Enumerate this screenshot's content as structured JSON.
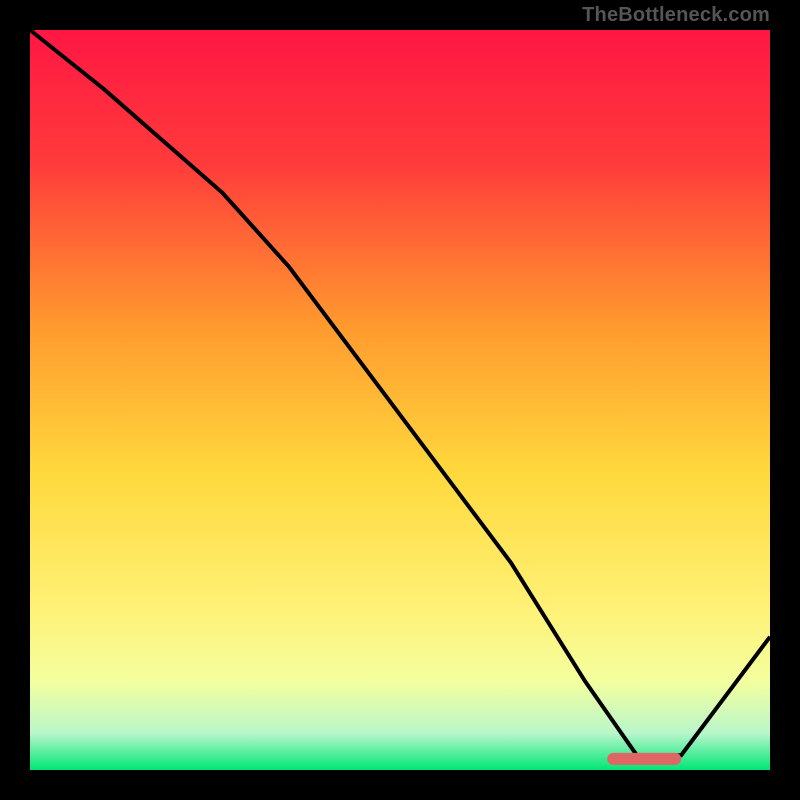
{
  "attribution": "TheBottleneck.com",
  "chart_data": {
    "type": "line",
    "title": "",
    "xlabel": "",
    "ylabel": "",
    "ylim": [
      0,
      100
    ],
    "xlim": [
      0,
      100
    ],
    "gradient_stops": [
      {
        "offset": 0,
        "color": "#ff1744"
      },
      {
        "offset": 18,
        "color": "#ff3b3b"
      },
      {
        "offset": 40,
        "color": "#ff9a2e"
      },
      {
        "offset": 60,
        "color": "#ffd93d"
      },
      {
        "offset": 78,
        "color": "#fff176"
      },
      {
        "offset": 88,
        "color": "#f4ff9e"
      },
      {
        "offset": 95,
        "color": "#b9f6ca"
      },
      {
        "offset": 100,
        "color": "#00e676"
      }
    ],
    "series": [
      {
        "name": "bottleneck-curve",
        "x": [
          0,
          10,
          26,
          35,
          50,
          65,
          75,
          82,
          88,
          100
        ],
        "y": [
          100,
          92,
          78,
          68,
          48,
          28,
          12,
          2,
          2,
          18
        ]
      }
    ],
    "marker": {
      "name": "optimal-range",
      "x_start": 78,
      "x_end": 88,
      "y": 1.5,
      "color": "#e06666"
    }
  }
}
